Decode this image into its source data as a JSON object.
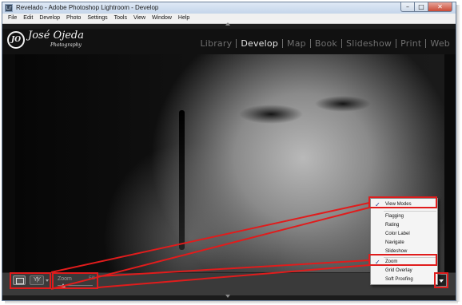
{
  "window": {
    "title": "Revelado - Adobe Photoshop Lightroom - Develop",
    "app_icon_glyph": "Lr",
    "controls": {
      "minimize": "–",
      "maximize": "□",
      "close": "✕"
    }
  },
  "menubar": {
    "items": [
      "File",
      "Edit",
      "Develop",
      "Photo",
      "Settings",
      "Tools",
      "View",
      "Window",
      "Help"
    ]
  },
  "identity_plate": {
    "badge": "JO",
    "name": "José Ojeda",
    "subtitle": "Photography"
  },
  "modules": {
    "items": [
      {
        "label": "Library",
        "active": false
      },
      {
        "label": "Develop",
        "active": true
      },
      {
        "label": "Map",
        "active": false
      },
      {
        "label": "Book",
        "active": false
      },
      {
        "label": "Slideshow",
        "active": false
      },
      {
        "label": "Print",
        "active": false
      },
      {
        "label": "Web",
        "active": false
      }
    ]
  },
  "photo": {
    "description_icon": "portrait-photo"
  },
  "toolbar": {
    "compare_glyph": "Y|Y",
    "zoom_label": "Zoom",
    "zoom_fill": "Fill",
    "zoom_level": 0.1
  },
  "context_menu": {
    "header": "View Modes",
    "items": [
      "Flagging",
      "Rating",
      "Color Label",
      "Navigate",
      "Slideshow"
    ],
    "zoom": "Zoom",
    "tail": [
      "Grid Overlay",
      "Soft Proofing"
    ],
    "checked": [
      "View Modes",
      "Zoom"
    ],
    "check_glyph": "✓"
  },
  "colors": {
    "annotation_red": "#e01c1c",
    "panel_bg": "#3a3a3a",
    "module_active": "#e4e4e4",
    "module_inactive": "#6f6f6f"
  }
}
